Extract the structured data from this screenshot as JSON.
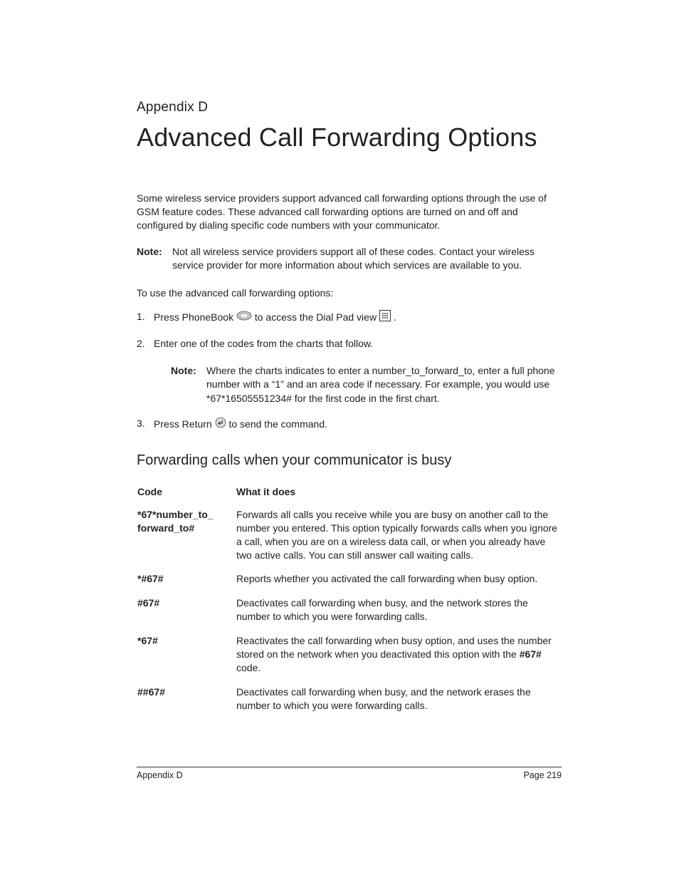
{
  "appendix_label": "Appendix D",
  "title": "Advanced Call Forwarding Options",
  "intro": "Some wireless service providers support advanced call forwarding options through the use of GSM feature codes. These advanced call forwarding options are turned on and off and configured by dialing specific code numbers with your communicator.",
  "top_note": {
    "label": "Note:",
    "body": "Not all wireless service providers support all of these codes. Contact your wireless service provider for more information about which services are available to you."
  },
  "procedure_lead": "To use the advanced call forwarding options:",
  "steps": {
    "s1_pre": "Press PhoneBook ",
    "s1_mid": " to access the Dial Pad view ",
    "s1_post": ".",
    "s2": "Enter one of the codes from the charts that follow.",
    "s2_note_label": "Note:",
    "s2_note_body": "Where the charts indicates to enter a number_to_forward_to, enter a full phone number with a “1” and an area code if necessary. For example, you would use *67*16505551234# for the first code in the first chart.",
    "s3_pre": "Press Return ",
    "s3_post": " to send the command."
  },
  "section_title": "Forwarding calls when your communicator is busy",
  "chart_data": {
    "type": "table",
    "columns": [
      "Code",
      "What it does"
    ],
    "rows": [
      {
        "code": "*67*number_to_ forward_to#",
        "what": "Forwards all calls you receive while you are busy on another call to the number you entered. This option typically forwards calls when you ignore a call, when you are on a wireless data call, or when you already have two active calls. You can still answer call waiting calls."
      },
      {
        "code": "*#67#",
        "what": "Reports whether you activated the call forwarding when busy option."
      },
      {
        "code": "#67#",
        "what": "Deactivates call forwarding when busy, and the network stores the number to which you were forwarding calls."
      },
      {
        "code": "*67#",
        "what_pre": "Reactivates the call forwarding when busy option, and uses the number stored on the network when you deactivated this option with the ",
        "what_bold": "#67#",
        "what_post": " code."
      },
      {
        "code": "##67#",
        "what": "Deactivates call forwarding when busy, and the network erases the number to which you were forwarding calls."
      }
    ]
  },
  "footer": {
    "left": "Appendix D",
    "right": "Page 219"
  }
}
